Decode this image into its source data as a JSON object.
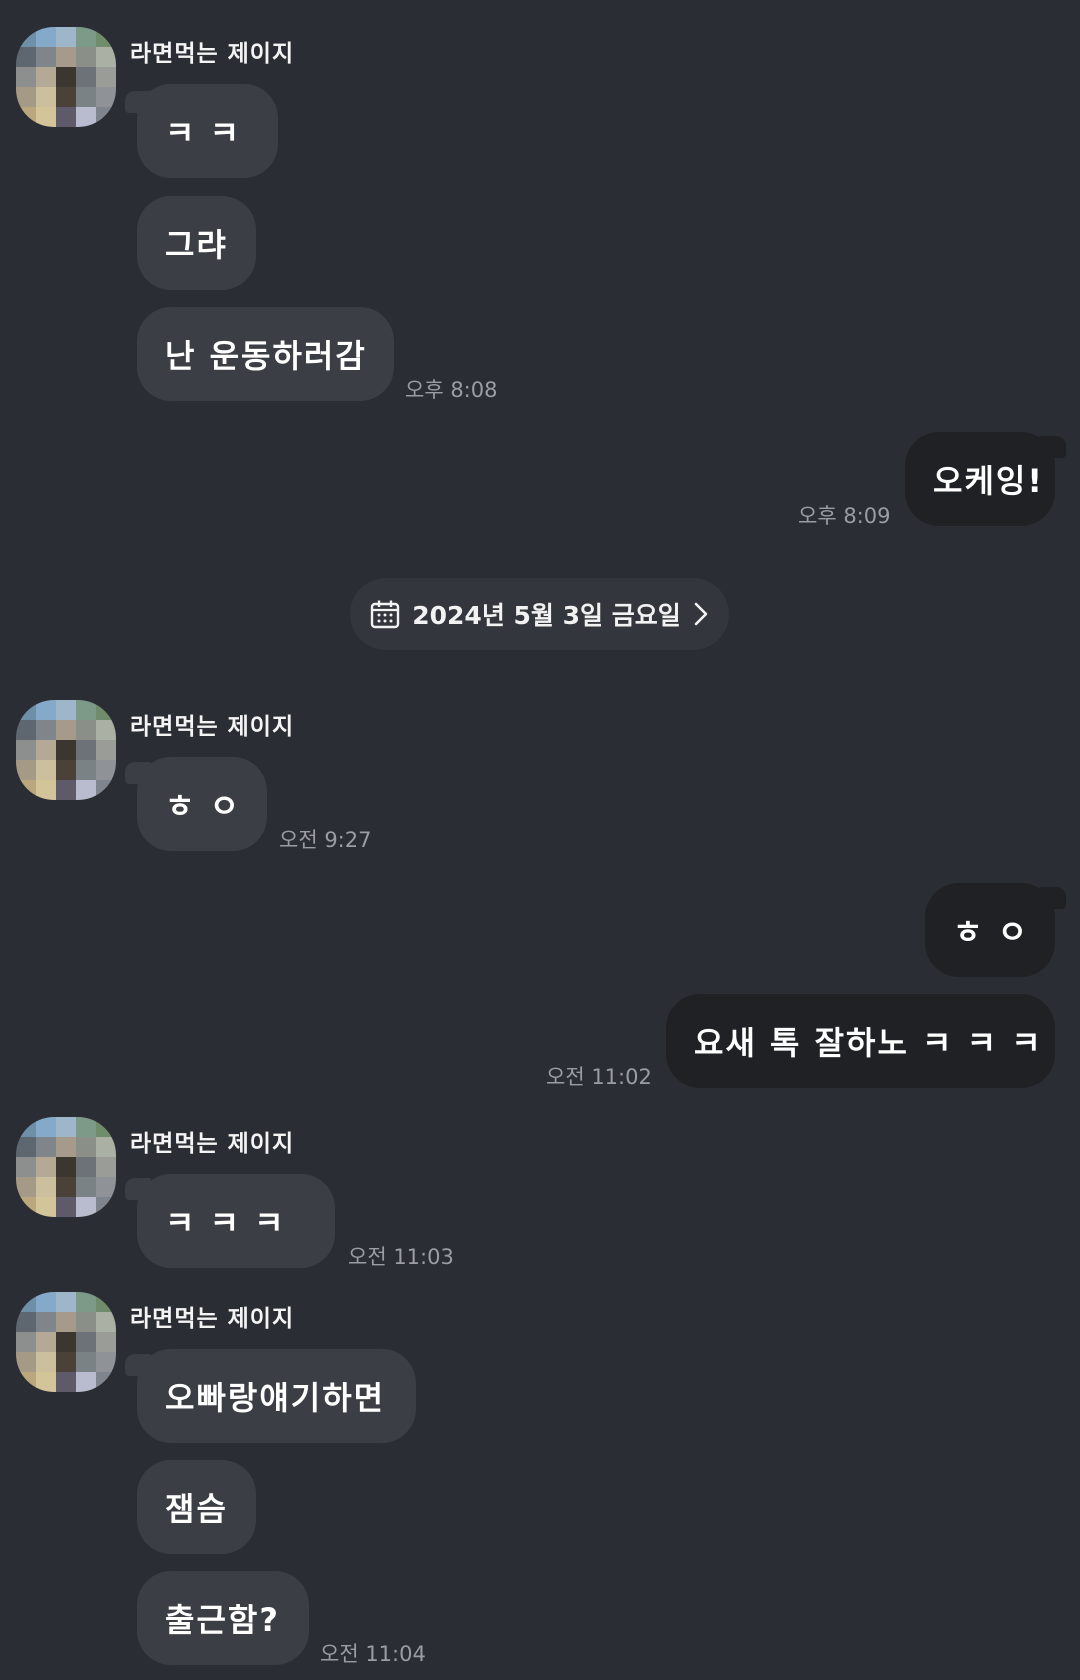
{
  "sender_name": "라면먹는 제이지",
  "date_divider": {
    "label": "2024년 5월 3일 금요일"
  },
  "messages": [
    {
      "side": "in",
      "text": "ㅋ ㅋ"
    },
    {
      "side": "in",
      "text": "그랴"
    },
    {
      "side": "in",
      "text": "난 운동하러감",
      "time": "오후 8:08"
    },
    {
      "side": "out",
      "text": "오케잉!",
      "time": "오후 8:09"
    },
    {
      "side": "in",
      "text": "ㅎ ㅇ",
      "time": "오전 9:27"
    },
    {
      "side": "out",
      "text": "ㅎ ㅇ"
    },
    {
      "side": "out",
      "text": "요새 톡 잘하노 ㅋ ㅋ ㅋ",
      "time": "오전 11:02"
    },
    {
      "side": "in",
      "text": "ㅋ ㅋ ㅋ",
      "time": "오전 11:03"
    },
    {
      "side": "in",
      "text": "오빠랑얘기하면"
    },
    {
      "side": "in",
      "text": "잼슴"
    },
    {
      "side": "in",
      "text": "출근함?",
      "time": "오전 11:04"
    }
  ]
}
